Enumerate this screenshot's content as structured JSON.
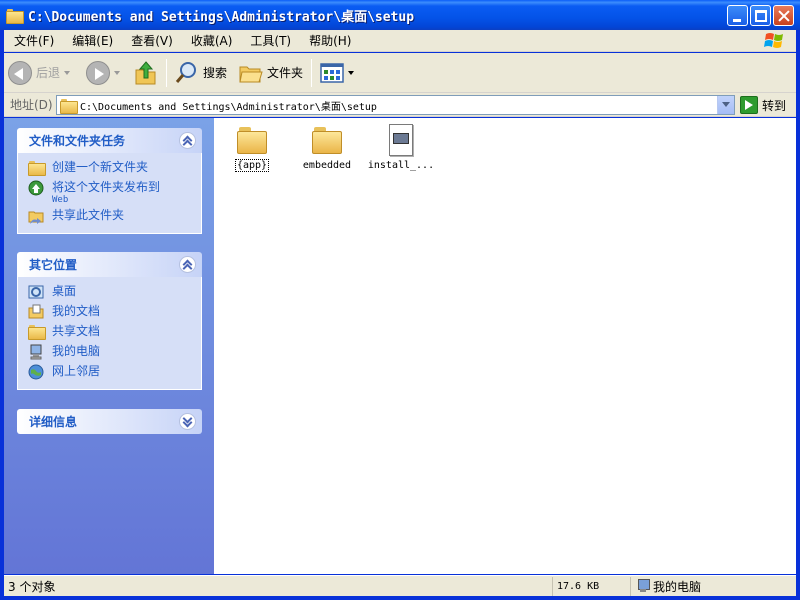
{
  "window": {
    "title": "C:\\Documents and Settings\\Administrator\\桌面\\setup"
  },
  "menu": [
    "文件(F)",
    "编辑(E)",
    "查看(V)",
    "收藏(A)",
    "工具(T)",
    "帮助(H)"
  ],
  "toolbar": {
    "back_label": "后退",
    "search_label": "搜索",
    "folders_label": "文件夹"
  },
  "address": {
    "label": "地址(D)",
    "path": "C:\\Documents and Settings\\Administrator\\桌面\\setup",
    "go_label": "转到"
  },
  "tasks_panel": {
    "title": "文件和文件夹任务",
    "items": [
      {
        "label": "创建一个新文件夹",
        "icon": "new-folder-icon"
      },
      {
        "label": "将这个文件夹发布到",
        "sub": "Web",
        "icon": "publish-web-icon"
      },
      {
        "label": "共享此文件夹",
        "icon": "share-folder-icon"
      }
    ]
  },
  "places_panel": {
    "title": "其它位置",
    "items": [
      {
        "label": "桌面",
        "icon": "desktop-icon"
      },
      {
        "label": "我的文档",
        "icon": "my-documents-icon"
      },
      {
        "label": "共享文档",
        "icon": "shared-documents-icon"
      },
      {
        "label": "我的电脑",
        "icon": "my-computer-icon"
      },
      {
        "label": "网上邻居",
        "icon": "network-places-icon"
      }
    ]
  },
  "details_panel": {
    "title": "详细信息"
  },
  "files": [
    {
      "name": "{app}",
      "type": "folder",
      "selected": true
    },
    {
      "name": "embedded",
      "type": "folder",
      "selected": false
    },
    {
      "name": "install_...",
      "type": "file",
      "selected": false
    }
  ],
  "status": {
    "count": "3 个对象",
    "size": "17.6 KB",
    "location": "我的电脑"
  },
  "colors": {
    "title_bar": "#0453e8",
    "task_pane": "#6f8ce0",
    "link_text": "#215dc6",
    "chrome": "#ece9d8"
  }
}
